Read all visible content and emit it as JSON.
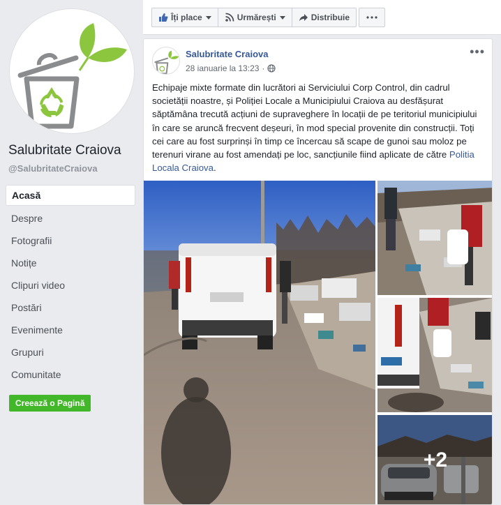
{
  "sidebar": {
    "page_name": "Salubritate Craiova",
    "page_handle": "@SalubritateCraiova",
    "nav": [
      {
        "label": "Acasă",
        "active": true
      },
      {
        "label": "Despre"
      },
      {
        "label": "Fotografii"
      },
      {
        "label": "Notițe"
      },
      {
        "label": "Clipuri video"
      },
      {
        "label": "Postări"
      },
      {
        "label": "Evenimente"
      },
      {
        "label": "Grupuri"
      },
      {
        "label": "Comunitate"
      }
    ],
    "create_page_label": "Creează o Pagină"
  },
  "actionbar": {
    "like_label": "Îți place",
    "follow_label": "Urmărești",
    "share_label": "Distribuie"
  },
  "post": {
    "author": "Salubritate Craiova",
    "date": "28 ianuarie la 13:23",
    "privacy_icon": "globe-icon",
    "text_main": "Echipaje mixte formate din lucrători ai Serviciului Corp Control, din cadrul societății noastre, și Poliției Locale a Municipiului Craiova au desfășurat săptămâna trecută acțiuni de supraveghere în locații de pe teritoriul municipiului în care se aruncă frecvent deșeuri, în mod special provenite din construcții. Toți cei care au fost surprinși în timp ce încercau să scape de gunoi sau moloz pe terenuri virane au fost amendați pe loc, sancțiunile fiind aplicate de către ",
    "text_link": "Politia Locala Craiova",
    "text_end": ".",
    "more_photos": "+2"
  },
  "colors": {
    "link": "#365899",
    "green_button": "#42b72a",
    "background": "#e9ebee"
  }
}
